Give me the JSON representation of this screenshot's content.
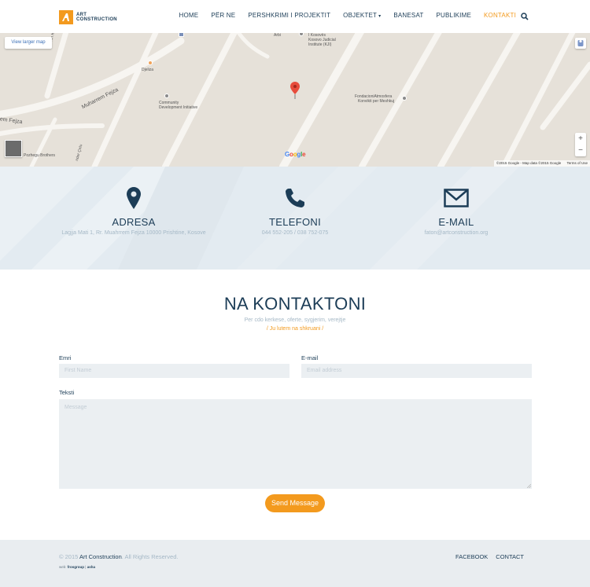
{
  "header": {
    "logo_line1": "ART",
    "logo_line2": "CONSTRUCTION",
    "nav": [
      {
        "label": "HOME"
      },
      {
        "label": "PËR NE"
      },
      {
        "label": "PERSHKRIMI I PROJEKTIT"
      },
      {
        "label": "OBJEKTET"
      },
      {
        "label": "BANESAT"
      },
      {
        "label": "PUBLIKIME"
      },
      {
        "label": "KONTAKTI"
      }
    ],
    "objektet_caret": "▾",
    "active": "KONTAKTI"
  },
  "map": {
    "view_larger": "View larger map",
    "labels": {
      "arbi": "Arbi",
      "kosoves1": "I Kosovës",
      "kosoves2": "Kosovo Judicial",
      "kosoves3": "Institute (KJI)",
      "ukshin": "Ukshin Ko",
      "djeliza": "Djeliza",
      "muharrem": "Muharrem Fejza",
      "community1": "Community",
      "community2": "Development Initiative",
      "fondacioni1": "FondacioniAtmosfera",
      "fondacioni2": "Konvikti per Meshkuj",
      "rem_fejza": "rem Fejza",
      "pozhegu": "Pozhegu Brothers",
      "celu": "nder Çelu"
    },
    "google": "Google",
    "attribution": "©2015 Google - Map data ©2015 Google",
    "terms": "Terms of Use",
    "zoom_in": "+",
    "zoom_out": "−"
  },
  "contact_info": [
    {
      "title": "ADRESA",
      "text": "Lagjja Mati 1, Rr. Muahrrem Fejza 10000 Prishtine, Kosove",
      "icon": "map-pin-icon"
    },
    {
      "title": "TELEFONI",
      "text": "044 552-205 / 038 752-075",
      "icon": "phone-icon"
    },
    {
      "title": "E-MAIL",
      "text": "faton@artconstruction.org",
      "icon": "envelope-icon"
    }
  ],
  "form": {
    "title": "NA KONTAKTONI",
    "subtitle": "Per cdo kerkese, oferte, sygjerim, verejtje",
    "subtitle2": "/ Ju lutem na shkruani /",
    "name_label": "Emri",
    "name_placeholder": "First Name",
    "email_label": "E-mail",
    "email_placeholder": "Email address",
    "text_label": "Teksti",
    "text_placeholder": "Message",
    "submit": "Send Message"
  },
  "footer": {
    "copyright_prefix": "© 2015",
    "brand": "Art Construction",
    "copyright_suffix": ". All Rights Reserved.",
    "credits_prefix": "web:",
    "credits_a": "frosgroup",
    "credits_sep": "|",
    "credits_b": "asha",
    "links": [
      "FACEBOOK",
      "CONTACT"
    ]
  },
  "colors": {
    "accent": "#f39a1e",
    "navy": "#1c3d57",
    "muted": "#a5b8c6"
  }
}
